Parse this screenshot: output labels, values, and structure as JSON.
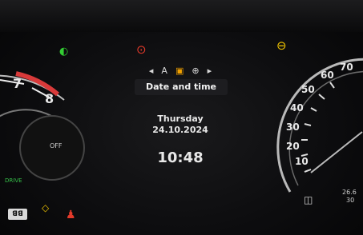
{
  "top_indicators": [
    {
      "name": "parking-light-icon",
      "color": "#33cc33",
      "glyph": "◐"
    },
    {
      "name": "brake-warning-icon",
      "color": "#e23a2a",
      "glyph": "⊙"
    },
    {
      "name": "tire-pressure-icon",
      "color": "#f0c400",
      "glyph": "⊖"
    }
  ],
  "menu": {
    "title": "Date and time",
    "nav": [
      "◂",
      "A",
      "▣",
      "⊕",
      "▸"
    ]
  },
  "datetime": {
    "day": "Thursday",
    "date": "24.10.2024",
    "time": "10:48"
  },
  "tachometer": {
    "ticks": [
      "7",
      "8"
    ],
    "off_label": "OFF",
    "drive_label": "DRIVE"
  },
  "speedometer": {
    "ticks": [
      "10",
      "20",
      "30",
      "40",
      "50",
      "60",
      "70"
    ],
    "odometer": "26.6",
    "odometer_sub": "30"
  },
  "bottom": {
    "badge": "ꓭꓭ",
    "left_glyph": "⊘"
  }
}
